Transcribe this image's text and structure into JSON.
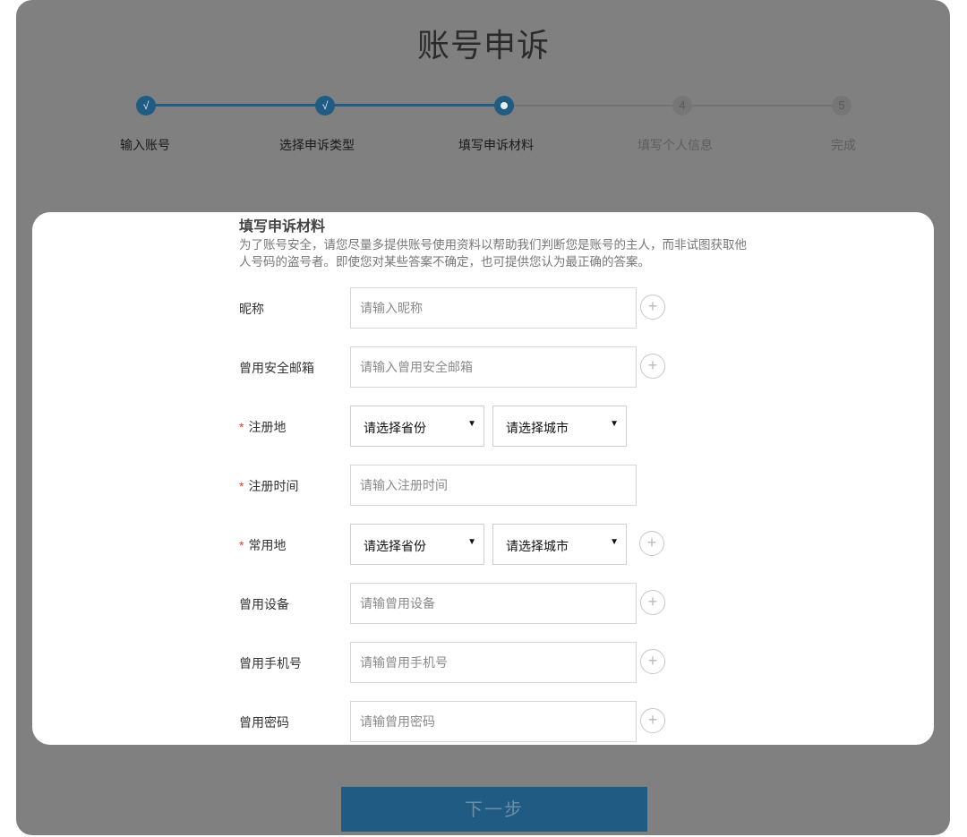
{
  "page": {
    "title": "账号申诉"
  },
  "stepper": {
    "steps": [
      {
        "label": "输入账号",
        "marker": "√",
        "state": "done"
      },
      {
        "label": "选择申诉类型",
        "marker": "√",
        "state": "done"
      },
      {
        "label": "填写申诉材料",
        "marker": "",
        "state": "current"
      },
      {
        "label": "填写个人信息",
        "marker": "4",
        "state": "todo"
      },
      {
        "label": "完成",
        "marker": "5",
        "state": "todo"
      }
    ]
  },
  "form": {
    "title": "填写申诉材料",
    "description": "为了账号安全，请您尽量多提供账号使用资料以帮助我们判断您是账号的主人，而非试图获取他人号码的盗号者。即使您对某些答案不确定，也可提供您认为最正确的答案。",
    "required_mark": "*",
    "add_symbol": "+",
    "select_caret": "▼",
    "fields": {
      "nickname": {
        "label": "昵称",
        "placeholder": "请输入昵称"
      },
      "email": {
        "label": "曾用安全邮箱",
        "placeholder": "请输入曾用安全邮箱"
      },
      "reg_place": {
        "label": "注册地",
        "province": "请选择省份",
        "city": "请选择城市"
      },
      "reg_time": {
        "label": "注册时间",
        "placeholder": "请输入注册时间"
      },
      "usual_place": {
        "label": "常用地",
        "province": "请选择省份",
        "city": "请选择城市"
      },
      "device": {
        "label": "曾用设备",
        "placeholder": "请输曾用设备"
      },
      "phone": {
        "label": "曾用手机号",
        "placeholder": "请输曾用手机号"
      },
      "password": {
        "label": "曾用密码",
        "placeholder": "请输曾用密码"
      }
    }
  },
  "actions": {
    "next_label": "下一步"
  },
  "colors": {
    "accent": "#1f5b82",
    "overlay": "#808080",
    "required": "#e53935"
  }
}
